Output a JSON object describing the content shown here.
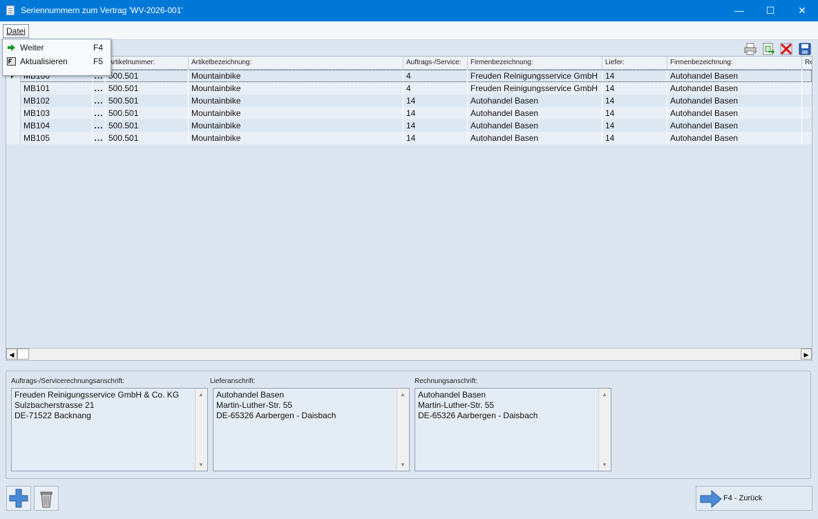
{
  "window": {
    "title": "Seriennummern zum Vertrag 'WV-2026-001'",
    "controls": {
      "minimize": "—",
      "maximize": "☐",
      "close": "✕"
    }
  },
  "menu": {
    "datei": "Datei",
    "items": [
      {
        "label": "Weiter",
        "shortcut": "F4",
        "icon": "arrow-right-icon"
      },
      {
        "label": "Aktualisieren",
        "shortcut": "F5",
        "icon": "refresh-icon"
      }
    ]
  },
  "toolbar": {
    "icons": [
      "print-icon",
      "excel-export-icon",
      "delete-red-x-icon",
      "save-disk-icon"
    ]
  },
  "grid": {
    "columns": [
      {
        "label": ""
      },
      {
        "label": ""
      },
      {
        "label": "Artikelnummer:"
      },
      {
        "label": "Artikelbezeichnung:"
      },
      {
        "label": "Auftrags-/Service:"
      },
      {
        "label": "Firmenbezeichnung:"
      },
      {
        "label": "Liefer:"
      },
      {
        "label": "Firmenbezeichnung:"
      },
      {
        "label": "Re"
      }
    ],
    "rows": [
      {
        "serial": "MB100",
        "dots": "...",
        "artnr": "500.501",
        "artbez": "Mountainbike",
        "auftrag": "4",
        "firma1": "Freuden Reinigungsservice GmbH",
        "liefer": "14",
        "firma2": "Autohandel Basen"
      },
      {
        "serial": "MB101",
        "dots": "...",
        "artnr": "500.501",
        "artbez": "Mountainbike",
        "auftrag": "4",
        "firma1": "Freuden Reinigungsservice GmbH",
        "liefer": "14",
        "firma2": "Autohandel Basen"
      },
      {
        "serial": "MB102",
        "dots": "...",
        "artnr": "500.501",
        "artbez": "Mountainbike",
        "auftrag": "14",
        "firma1": "Autohandel Basen",
        "liefer": "14",
        "firma2": "Autohandel Basen"
      },
      {
        "serial": "MB103",
        "dots": "...",
        "artnr": "500.501",
        "artbez": "Mountainbike",
        "auftrag": "14",
        "firma1": "Autohandel Basen",
        "liefer": "14",
        "firma2": "Autohandel Basen"
      },
      {
        "serial": "MB104",
        "dots": "...",
        "artnr": "500.501",
        "artbez": "Mountainbike",
        "auftrag": "14",
        "firma1": "Autohandel Basen",
        "liefer": "14",
        "firma2": "Autohandel Basen"
      },
      {
        "serial": "MB105",
        "dots": "...",
        "artnr": "500.501",
        "artbez": "Mountainbike",
        "auftrag": "14",
        "firma1": "Autohandel Basen",
        "liefer": "14",
        "firma2": "Autohandel Basen"
      }
    ]
  },
  "addresses": {
    "auftrag": {
      "label": "Auftrags-/Servicerechnungsanschrift:",
      "text": "Freuden Reinigungsservice GmbH & Co. KG\nSulzbacherstrasse 21\nDE-71522 Backnang"
    },
    "liefer": {
      "label": "Lieferanschrift:",
      "text": "Autohandel Basen\nMartin-Luther-Str. 55\nDE-65326 Aarbergen - Daisbach"
    },
    "rechnung": {
      "label": "Rechnungsanschrift:",
      "text": "Autohandel Basen\nMartin-Luther-Str. 55\nDE-65326 Aarbergen - Daisbach"
    }
  },
  "footer": {
    "back_label": "F4 - Zurück",
    "add_icon": "plus-icon",
    "trash_icon": "trash-icon"
  }
}
